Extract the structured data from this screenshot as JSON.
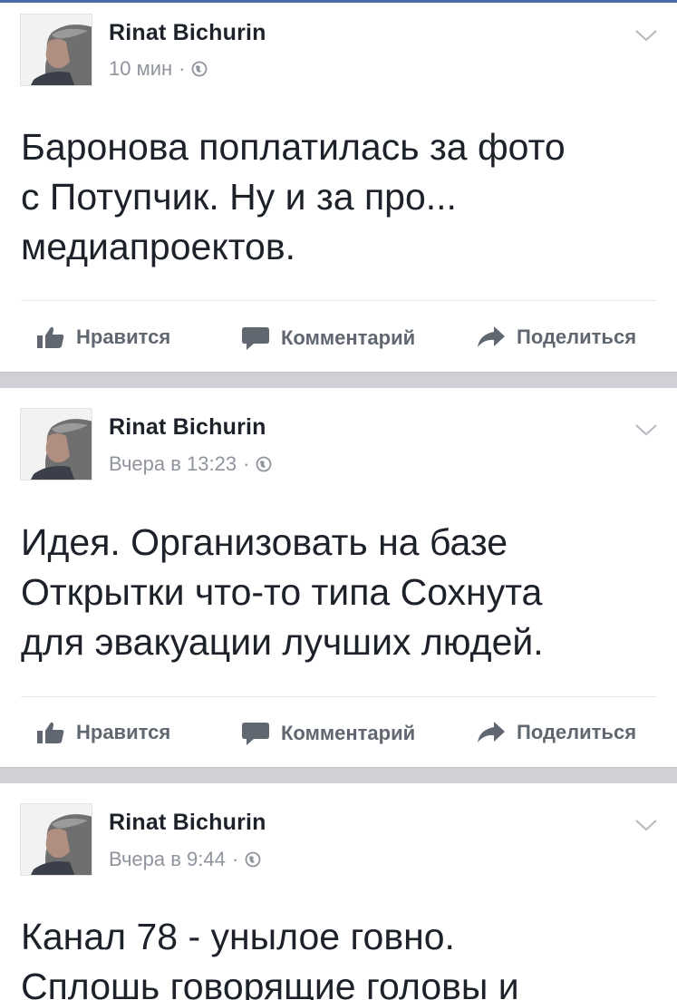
{
  "colors": {
    "accent": "#4a6aa8",
    "text": "#1d2129",
    "muted": "#90949c",
    "action": "#606770",
    "separator": "#cfd1d6"
  },
  "actions": {
    "like": "Нравится",
    "comment": "Комментарий",
    "share": "Поделиться"
  },
  "icons": {
    "like": "thumbs-up-icon",
    "comment": "comment-bubble-icon",
    "share": "share-arrow-icon",
    "privacy": "globe-icon",
    "menu": "chevron-down-icon"
  },
  "posts": [
    {
      "author": "Rinat Bichurin",
      "time": "10 мин",
      "separator": "·",
      "text": "Баронова поплатилась за фото\nс Потупчик. Ну и за про...\nмедиапроектов."
    },
    {
      "author": "Rinat Bichurin",
      "time": "Вчера в 13:23",
      "separator": "·",
      "text": "Идея. Организовать на базе\nОткрытки что-то типа Сохнута\nдля эвакуации лучших людей."
    },
    {
      "author": "Rinat Bichurin",
      "time": "Вчера в 9:44",
      "separator": "·",
      "text": "Канал 78 - унылое говно.\nСплошь говорящие головы и"
    }
  ]
}
